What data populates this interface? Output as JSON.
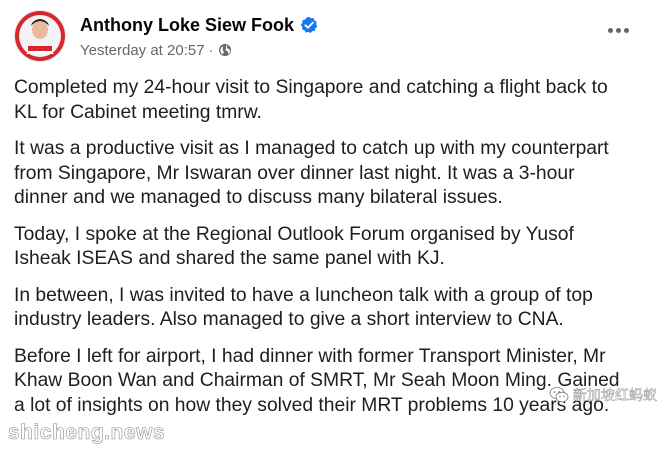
{
  "post": {
    "author": {
      "name": "Anthony Loke Siew Fook",
      "verified_icon": "verified-badge-icon",
      "avatar_icon": "profile-avatar"
    },
    "meta": {
      "timestamp": "Yesterday at 20:57",
      "separator": "·",
      "audience_icon": "globe-icon"
    },
    "more_icon": "more-options-icon",
    "paragraphs": [
      {
        "lines": [
          "Completed my 24-hour visit to Singapore and catching a flight back to",
          "KL for Cabinet meeting tmrw."
        ]
      },
      {
        "lines": [
          "It was a productive visit as I managed to catch up with my counterpart",
          "from Singapore, Mr Iswaran over dinner last night. It was a 3-hour",
          "dinner and we managed to discuss many bilateral issues."
        ]
      },
      {
        "lines": [
          "Today, I spoke at the Regional Outlook Forum organised by Yusof",
          "Isheak ISEAS and shared the same panel with KJ."
        ]
      },
      {
        "lines": [
          "In between, I was invited to have a luncheon talk with a group of top",
          "industry leaders. Also managed to give a short interview to CNA."
        ]
      },
      {
        "lines": [
          "Before I left for airport, I had dinner with former Transport Minister, Mr",
          "Khaw Boon Wan and Chairman of SMRT, Mr Seah Moon Ming. Gained",
          "a lot of insights on how they solved their MRT problems 10 years ago."
        ]
      }
    ]
  },
  "watermarks": {
    "left": "shicheng.news",
    "right": "新加坡红蚂蚁",
    "right_icon": "wechat-icon"
  },
  "colors": {
    "verified": "#1877f2",
    "secondary_text": "#65676b",
    "primary_text": "#050505",
    "avatar_red": "#d7262c"
  }
}
